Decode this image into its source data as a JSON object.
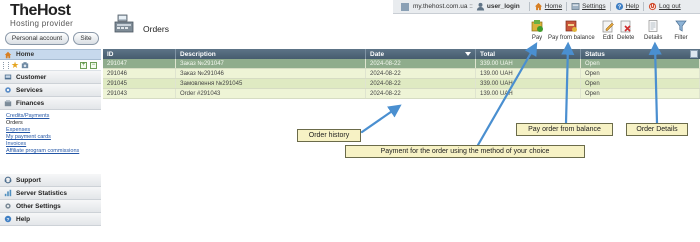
{
  "brand": {
    "name": "TheHost",
    "tagline": "Hosting provider"
  },
  "header_buttons": {
    "account": "Personal account",
    "site": "Site"
  },
  "page": {
    "title": "Orders"
  },
  "top_bar": {
    "server": "my.thehost.com.ua ::",
    "user": "user_login",
    "home": "Home",
    "settings": "Settings",
    "help": "Help",
    "logout": "Log out"
  },
  "toolbar": [
    {
      "key": "pay",
      "label": "Pay",
      "icon": "pay-icon"
    },
    {
      "key": "pay_balance",
      "label": "Pay from balance",
      "icon": "pay-from-balance-icon"
    },
    {
      "key": "edit",
      "label": "Edit",
      "icon": "edit-icon"
    },
    {
      "key": "delete",
      "label": "Delete",
      "icon": "delete-icon"
    },
    {
      "key": "details",
      "label": "Details",
      "icon": "details-icon"
    },
    {
      "key": "filter",
      "label": "Filter",
      "icon": "filter-icon"
    }
  ],
  "sidebar": {
    "home": "Home",
    "sections": [
      {
        "label": "Customer",
        "icon": "customer-icon"
      },
      {
        "label": "Services",
        "icon": "services-icon"
      },
      {
        "label": "Finances",
        "icon": "finances-icon"
      }
    ],
    "finance_items": [
      "Credits/Payments",
      "Orders",
      "Expenses",
      "My payment cards",
      "Invoices",
      "Affiliate program commissions"
    ],
    "bottom_sections": [
      {
        "label": "Support",
        "icon": "support-icon"
      },
      {
        "label": "Server Statistics",
        "icon": "server-statistics-icon"
      },
      {
        "label": "Other Settings",
        "icon": "other-settings-icon"
      },
      {
        "label": "Help",
        "icon": "help-icon"
      }
    ]
  },
  "table": {
    "columns": [
      "ID",
      "Description",
      "Date",
      "Total",
      "Status"
    ],
    "rows": [
      {
        "id": "291047",
        "description": "Заказ №291047",
        "date": "2024-08-22",
        "total": "339.00 UAH",
        "status": "Open"
      },
      {
        "id": "291046",
        "description": "Заказ №291046",
        "date": "2024-08-22",
        "total": "139.00 UAH",
        "status": "Open"
      },
      {
        "id": "291045",
        "description": "Замовлення №291045",
        "date": "2024-08-22",
        "total": "339.00 UAH",
        "status": "Open"
      },
      {
        "id": "291043",
        "description": "Order #291043",
        "date": "2024-08-22",
        "total": "139.00 UAH",
        "status": "Open"
      }
    ]
  },
  "callouts": {
    "order_history": "Order history",
    "payment": "Payment for the order using the method of your choice",
    "pay_from_balance": "Pay order from balance",
    "order_details": "Order Details"
  },
  "colors": {
    "header_bg": "#465c6e",
    "selected_row": "#8fac8c",
    "row_light": "#eef4d6",
    "row_dark": "#dfeac2",
    "callout_bg": "#f7f2c5",
    "arrow": "#4a8fd0"
  }
}
